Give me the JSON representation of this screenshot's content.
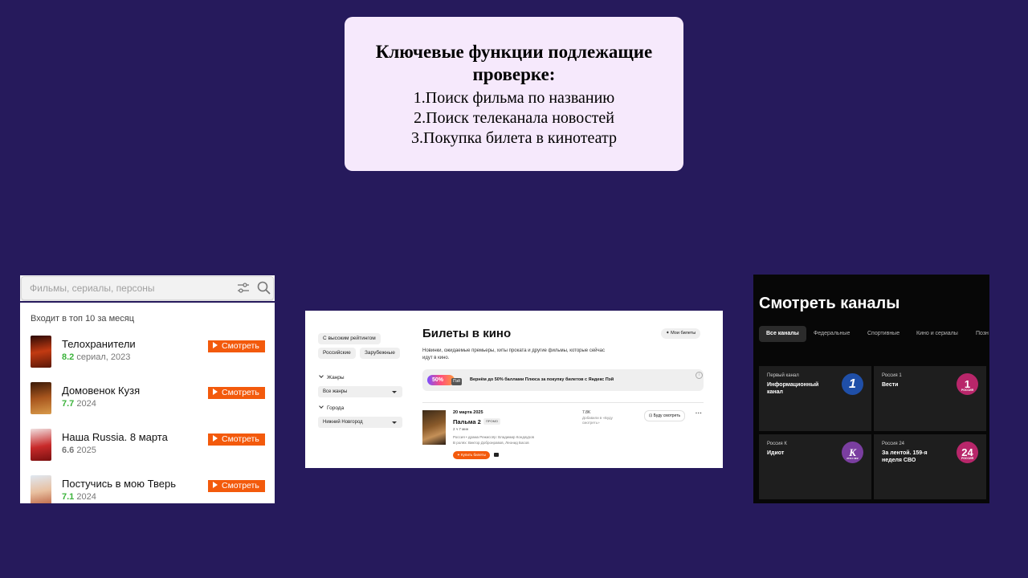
{
  "title_card": {
    "heading": "Ключевые функции подлежащие проверке:",
    "items": [
      "1.Поиск фильма по названию",
      "2.Поиск телеканала  новостей",
      "3.Покупка  билета в кинотеатр"
    ]
  },
  "search_panel": {
    "placeholder": "Фильмы, сериалы, персоны",
    "dropdown_heading": "Входит в топ 10 за месяц",
    "watch_label": "Смотреть",
    "results": [
      {
        "title": "Телохранители",
        "rating": "8.2",
        "meta": "сериал, 2023",
        "rating_color": "#3bb33b"
      },
      {
        "title": "Домовенок Кузя",
        "rating": "7.7",
        "meta": "2024",
        "rating_color": "#3bb33b"
      },
      {
        "title": "Наша Russia. 8 марта",
        "rating": "6.6",
        "meta": "2025",
        "rating_color": "#777777"
      },
      {
        "title": "Постучись в мою Тверь",
        "rating": "7.1",
        "meta": "2024",
        "rating_color": "#3bb33b"
      }
    ]
  },
  "tickets_panel": {
    "filters": {
      "high_rating": "С высоким рейтингом",
      "russian": "Российские",
      "foreign": "Зарубежные",
      "genres_label": "Жанры",
      "genres_value": "Все жанры",
      "cities_label": "Города",
      "cities_value": "Нижний Новгород"
    },
    "title": "Билеты в кино",
    "my_tickets": "Мои билеты",
    "description": "Новинки, ожидаемые премьеры, хиты проката и другие фильмы, которые сейчас идут в кино.",
    "promo": {
      "badge": "50%",
      "pay": "Пэй",
      "text": "Вернём до 50% баллами Плюса за покупку билетов с Яндекс Пэй"
    },
    "film": {
      "date": "20 марта 2025",
      "title": "Пальма 2",
      "promo_tag": "ПРОМО",
      "duration": "2 ч 7 мин",
      "info1": "Россия • драма  Режиссёр: Владимир Кондауров",
      "info2": "В ролях: Виктор Добронравов, Леонид Басов",
      "rating": "7.8K",
      "want": "Добавили в «Буду смотреть»",
      "will_watch": "Буду смотреть",
      "buy": "Купить билеты"
    }
  },
  "channels_panel": {
    "title": "Смотреть каналы",
    "tabs": [
      "Все каналы",
      "Федеральные",
      "Спортивные",
      "Кино и сериалы",
      "Позн"
    ],
    "cards": [
      {
        "channel": "Первый канал",
        "show": "Информационный канал",
        "logo": "1",
        "logo_color": "#1f4fa8"
      },
      {
        "channel": "Россия 1",
        "show": "Вести",
        "logo": "1",
        "logo_sub": "РОССИЯ",
        "logo_color": "#b8266a"
      },
      {
        "channel": "Россия К",
        "show": "Идиот",
        "logo": "К",
        "logo_sub": "РОССИЯ",
        "logo_color": "#7a3ea0"
      },
      {
        "channel": "Россия 24",
        "show": "За лентой. 159-я неделя СВО",
        "logo": "24",
        "logo_sub": "РОССИЯ",
        "logo_color": "#b8266a"
      }
    ]
  },
  "colors": {
    "background": "#261a5c",
    "card": "#f6e9fc",
    "accent_orange": "#f35a0c",
    "rating_green": "#3bb33b"
  }
}
